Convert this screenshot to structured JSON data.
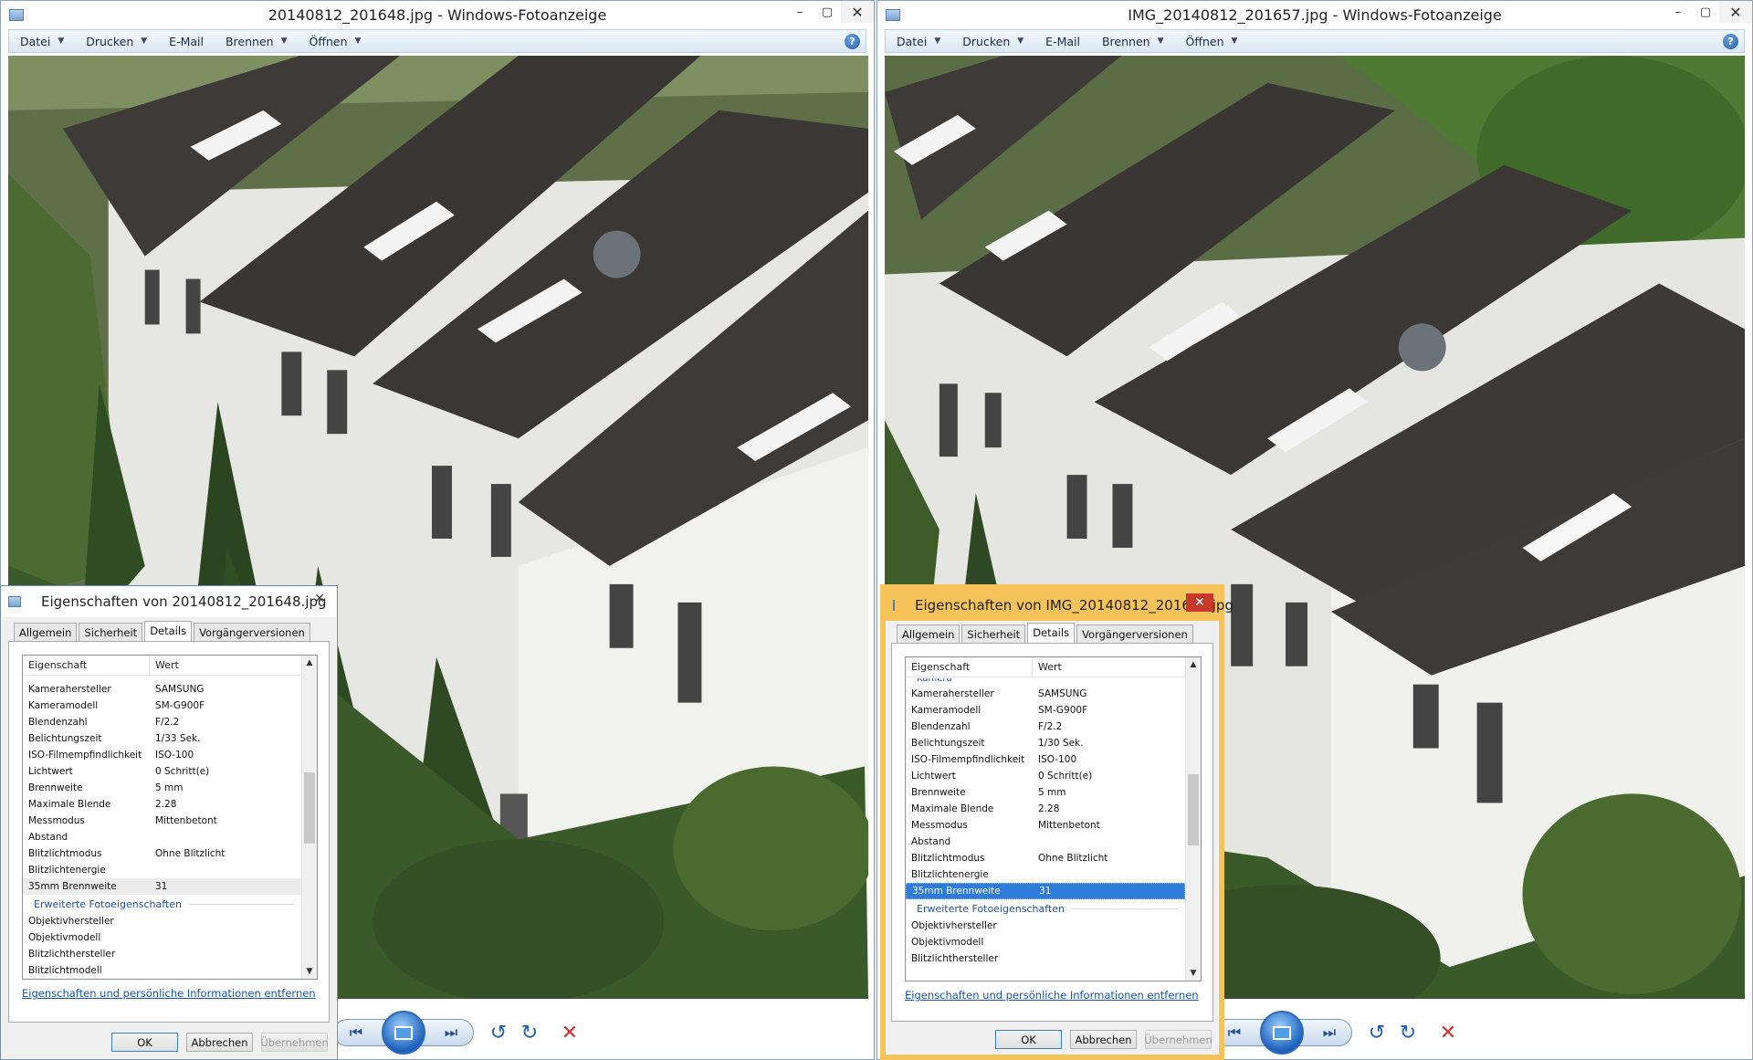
{
  "left_window": {
    "title": "20140812_201648.jpg - Windows-Fotoanzeige",
    "menu": [
      {
        "label": "Datei",
        "dropdown": true
      },
      {
        "label": "Drucken",
        "dropdown": true
      },
      {
        "label": "E-Mail",
        "dropdown": false
      },
      {
        "label": "Brennen",
        "dropdown": true
      },
      {
        "label": "Öffnen",
        "dropdown": true
      }
    ],
    "help_label": "?",
    "controls": {
      "minimize": "–",
      "maximize": "▢",
      "close": "✕"
    },
    "dialog": {
      "title": "Eigenschaften von 20140812_201648.jpg",
      "close": "✕",
      "tabs": [
        "Allgemein",
        "Sicherheit",
        "Details",
        "Vorgängerversionen"
      ],
      "active_tab": "Details",
      "col_property": "Eigenschaft",
      "col_value": "Wert",
      "rows": [
        {
          "k": "Kamerahersteller",
          "v": "SAMSUNG"
        },
        {
          "k": "Kameramodell",
          "v": "SM-G900F"
        },
        {
          "k": "Blendenzahl",
          "v": "F/2.2"
        },
        {
          "k": "Belichtungszeit",
          "v": "1/33 Sek."
        },
        {
          "k": "ISO-Filmempfindlichkeit",
          "v": "ISO-100"
        },
        {
          "k": "Lichtwert",
          "v": "0 Schritt(e)"
        },
        {
          "k": "Brennweite",
          "v": "5 mm"
        },
        {
          "k": "Maximale Blende",
          "v": "2.28"
        },
        {
          "k": "Messmodus",
          "v": "Mittenbetont"
        },
        {
          "k": "Abstand",
          "v": ""
        },
        {
          "k": "Blitzlichtmodus",
          "v": "Ohne Blitzlicht"
        },
        {
          "k": "Blitzlichtenergie",
          "v": ""
        },
        {
          "k": "35mm Brennweite",
          "v": "31"
        }
      ],
      "section": "Erweiterte Fotoeigenschaften",
      "extra_rows": [
        {
          "k": "Objektivhersteller",
          "v": ""
        },
        {
          "k": "Objektivmodell",
          "v": ""
        },
        {
          "k": "Blitzlichthersteller",
          "v": ""
        },
        {
          "k": "Blitzlichtmodell",
          "v": ""
        }
      ],
      "remove_link": "Eigenschaften und persönliche Informationen entfernen",
      "ok": "OK",
      "cancel": "Abbrechen",
      "apply": "Übernehmen"
    }
  },
  "right_window": {
    "title": "IMG_20140812_201657.jpg - Windows-Fotoanzeige",
    "menu": [
      {
        "label": "Datei",
        "dropdown": true
      },
      {
        "label": "Drucken",
        "dropdown": true
      },
      {
        "label": "E-Mail",
        "dropdown": false
      },
      {
        "label": "Brennen",
        "dropdown": true
      },
      {
        "label": "Öffnen",
        "dropdown": true
      }
    ],
    "help_label": "?",
    "controls": {
      "minimize": "–",
      "maximize": "▢",
      "close": "✕"
    },
    "dialog": {
      "title": "Eigenschaften von IMG_20140812_201657.jpg",
      "close": "✕",
      "tabs": [
        "Allgemein",
        "Sicherheit",
        "Details",
        "Vorgängerversionen"
      ],
      "active_tab": "Details",
      "col_property": "Eigenschaft",
      "col_value": "Wert",
      "group_cut": "Kamera",
      "rows": [
        {
          "k": "Kamerahersteller",
          "v": "SAMSUNG"
        },
        {
          "k": "Kameramodell",
          "v": "SM-G900F"
        },
        {
          "k": "Blendenzahl",
          "v": "F/2.2"
        },
        {
          "k": "Belichtungszeit",
          "v": "1/30 Sek."
        },
        {
          "k": "ISO-Filmempfindlichkeit",
          "v": "ISO-100"
        },
        {
          "k": "Lichtwert",
          "v": "0 Schritt(e)"
        },
        {
          "k": "Brennweite",
          "v": "5 mm"
        },
        {
          "k": "Maximale Blende",
          "v": "2.28"
        },
        {
          "k": "Messmodus",
          "v": "Mittenbetont"
        },
        {
          "k": "Abstand",
          "v": ""
        },
        {
          "k": "Blitzlichtmodus",
          "v": "Ohne Blitzlicht"
        },
        {
          "k": "Blitzlichtenergie",
          "v": ""
        },
        {
          "k": "35mm Brennweite",
          "v": "31"
        }
      ],
      "section": "Erweiterte Fotoeigenschaften",
      "extra_rows": [
        {
          "k": "Objektivhersteller",
          "v": ""
        },
        {
          "k": "Objektivmodell",
          "v": ""
        },
        {
          "k": "Blitzlichthersteller",
          "v": ""
        }
      ],
      "remove_link": "Eigenschaften und persönliche Informationen entfernen",
      "ok": "OK",
      "cancel": "Abbrechen",
      "apply": "Übernehmen"
    }
  },
  "icons": {
    "prev": "⏮",
    "next": "⏭",
    "rotate_ccw": "↺",
    "rotate_cw": "↻",
    "delete": "✕"
  },
  "colors": {
    "selection": "#2e7bd9",
    "active_dialog_frame": "#f6c35a",
    "link": "#1553b6"
  }
}
